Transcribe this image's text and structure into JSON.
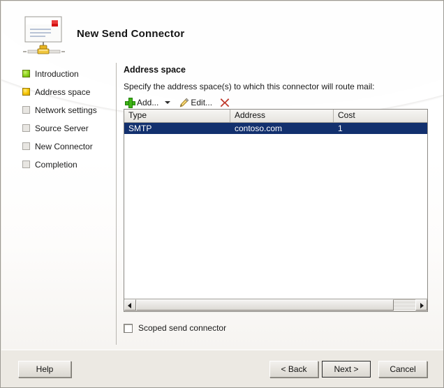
{
  "window": {
    "title": "New Send Connector",
    "icon": "send-connector-icon"
  },
  "sidebar": {
    "items": [
      {
        "label": "Introduction",
        "state": "done",
        "icon": "status-green-square-icon"
      },
      {
        "label": "Address space",
        "state": "current",
        "icon": "status-amber-square-icon"
      },
      {
        "label": "Network settings",
        "state": "todo",
        "icon": "status-empty-square-icon"
      },
      {
        "label": "Source Server",
        "state": "todo",
        "icon": "status-empty-square-icon"
      },
      {
        "label": "New Connector",
        "state": "todo",
        "icon": "status-empty-square-icon"
      },
      {
        "label": "Completion",
        "state": "todo",
        "icon": "status-empty-square-icon"
      }
    ]
  },
  "main": {
    "section_title": "Address space",
    "instruction": "Specify the address space(s) to which this connector will route mail:",
    "toolbar": {
      "add_label": "Add...",
      "add_icon": "green-plus-icon",
      "add_dropdown_icon": "chevron-down-icon",
      "edit_label": "Edit...",
      "edit_icon": "pencil-icon",
      "delete_icon": "red-x-icon"
    },
    "table": {
      "columns": [
        "Type",
        "Address",
        "Cost"
      ],
      "rows": [
        {
          "type": "SMTP",
          "address": "contoso.com",
          "cost": "1",
          "selected": true
        }
      ]
    },
    "scrollbar": {
      "left_icon": "scroll-left-arrow-icon",
      "right_icon": "scroll-right-arrow-icon"
    },
    "scoped_checkbox": {
      "label": "Scoped send connector",
      "checked": false
    }
  },
  "footer": {
    "help_label": "Help",
    "back_label": "< Back",
    "next_label": "Next >",
    "cancel_label": "Cancel"
  },
  "colors": {
    "selection_blue": "#12306e",
    "accent_green": "#3fb317",
    "accent_amber": "#f5c500",
    "delete_red": "#c0392b",
    "window_bg": "#ece9e3"
  }
}
